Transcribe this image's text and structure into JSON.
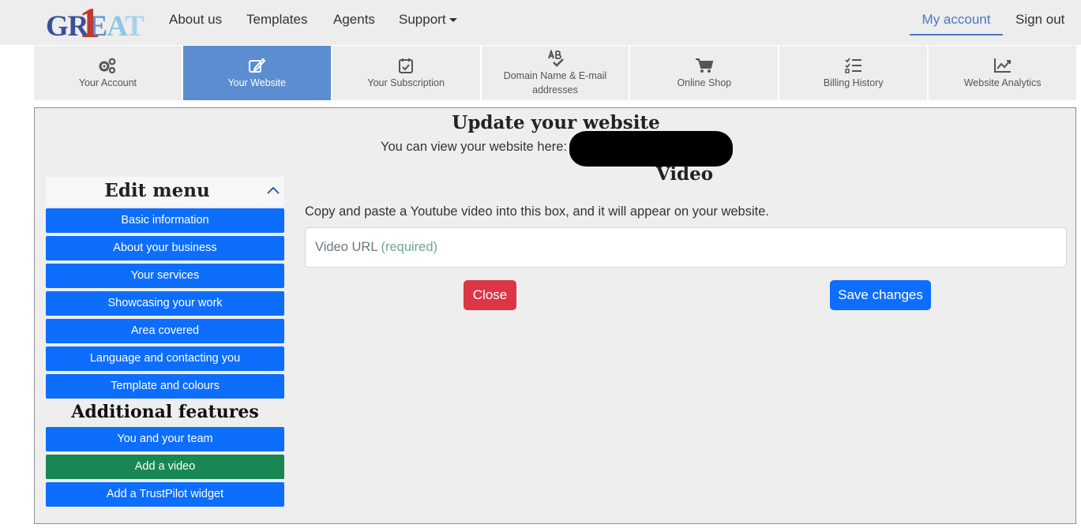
{
  "logo": {
    "text_parts": [
      "GR",
      "E",
      "A",
      "T"
    ],
    "numeral": "1"
  },
  "nav": {
    "about": "About us",
    "templates": "Templates",
    "agents": "Agents",
    "support": "Support",
    "my_account": "My account",
    "sign_out": "Sign out"
  },
  "tabs": [
    {
      "label": "Your Account",
      "icon": "gears-icon"
    },
    {
      "label": "Your Website",
      "icon": "edit-icon",
      "active": true
    },
    {
      "label": "Your Subscription",
      "icon": "calendar-check-icon"
    },
    {
      "label": "Domain Name & E-mail addresses",
      "icon": "spellcheck-icon"
    },
    {
      "label": "Online Shop",
      "icon": "cart-icon"
    },
    {
      "label": "Billing History",
      "icon": "list-check-icon"
    },
    {
      "label": "Website Analytics",
      "icon": "chart-line-icon"
    }
  ],
  "main": {
    "title": "Update your website",
    "view_text": "You can view your website here:",
    "section_title": "Video",
    "instructions": "Copy and paste a Youtube video into this box, and it will appear on your website.",
    "url_placeholder": "Video URL",
    "url_required": "(required)",
    "close_label": "Close",
    "save_label": "Save changes"
  },
  "sidebar": {
    "edit_menu_title": "Edit menu",
    "items": [
      "Basic information",
      "About your business",
      "Your services",
      "Showcasing your work",
      "Area covered",
      "Language and contacting you",
      "Template and colours"
    ],
    "additional_title": "Additional features",
    "additional_items": [
      "You and your team",
      "Add a video",
      "Add a TrustPilot widget"
    ],
    "active_item": "Add a video"
  },
  "colors": {
    "primary": "#0d6efd",
    "active_green": "#198754",
    "danger": "#dc3545",
    "active_tab": "#5b8dd0"
  }
}
